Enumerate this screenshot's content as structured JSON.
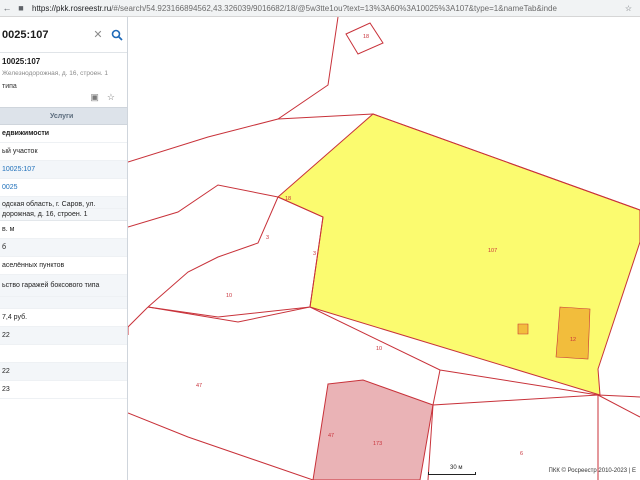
{
  "browser": {
    "url_host": "https://pkk.rosreestr.ru",
    "url_path": "/#/search/54.923166894562,43.326039/9016682/18/@5w3tte1ou?text=13%3A60%3A10025%3A107&type=1&nameTab&inde",
    "icons": [
      "back-icon",
      "lock-icon",
      "star-icon"
    ]
  },
  "panel": {
    "search_value": "0025:107",
    "object_number": "10025:107",
    "object_address": "Железнодорожная, д. 16, строен. 1",
    "object_type": "типа",
    "tab_services": "Услуги",
    "rows": [
      "едвижимости",
      "ый участок",
      "10025:107",
      "0025",
      "одская область, г. Саров, ул.",
      "дорожная, д. 16, строен. 1",
      "в. м",
      "б",
      "аселённых пунктов",
      "ьство гаражей боксового типа",
      "",
      "7,4 руб.",
      "22",
      "",
      "22",
      "23"
    ]
  },
  "map": {
    "parcel_labels": {
      "p18": "18",
      "p107": "107",
      "p3a": "3",
      "p3b": "3",
      "p10a": "10",
      "p10b": "10",
      "p47a": "47",
      "p47b": "47",
      "p173": "173",
      "p6": "6",
      "p12": "12",
      "pA": "18"
    },
    "scale": "30 м",
    "footer": "ПКК © Росреестр 2010-2023 | Е",
    "colors": {
      "selected_parcel": "#fbfb6f",
      "building": "#f2bd3c",
      "pink_parcel": "#eab3b6",
      "boundary": "#c8323a"
    }
  }
}
